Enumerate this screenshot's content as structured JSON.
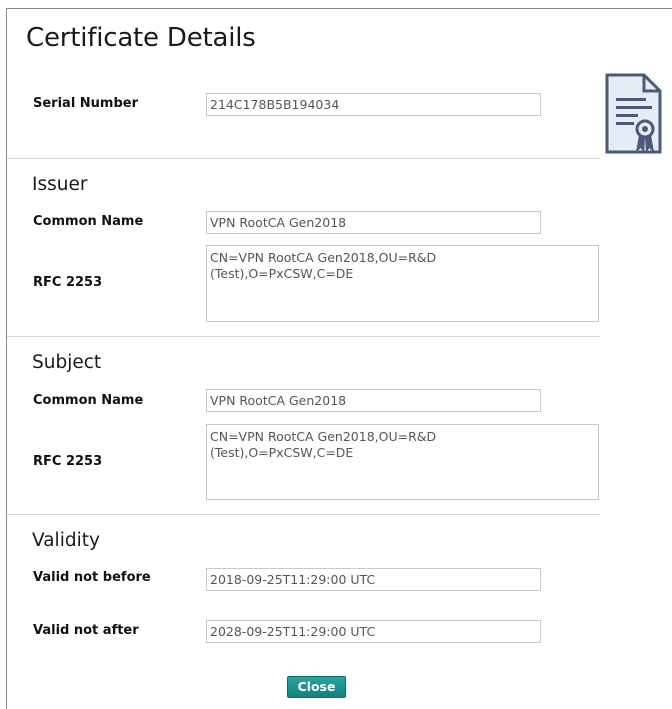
{
  "dialog": {
    "title": "Certificate Details",
    "icon": "certificate-icon",
    "close_label": "Close"
  },
  "serial": {
    "label": "Serial Number",
    "value": "214C178B5B194034"
  },
  "issuer": {
    "heading": "Issuer",
    "common_name_label": "Common Name",
    "common_name": "VPN RootCA Gen2018",
    "rfc_label": "RFC 2253",
    "rfc_value": "CN=VPN RootCA Gen2018,OU=R&D\n(Test),O=PxCSW,C=DE"
  },
  "subject": {
    "heading": "Subject",
    "common_name_label": "Common Name",
    "common_name": "VPN RootCA Gen2018",
    "rfc_label": "RFC 2253",
    "rfc_value": "CN=VPN RootCA Gen2018,OU=R&D\n(Test),O=PxCSW,C=DE"
  },
  "validity": {
    "heading": "Validity",
    "not_before_label": "Valid not before",
    "not_before": "2018-09-25T11:29:00 UTC",
    "not_after_label": "Valid not after",
    "not_after": "2028-09-25T11:29:00 UTC"
  },
  "colors": {
    "button": "#1a8e8a",
    "icon": "#4a5a78"
  }
}
